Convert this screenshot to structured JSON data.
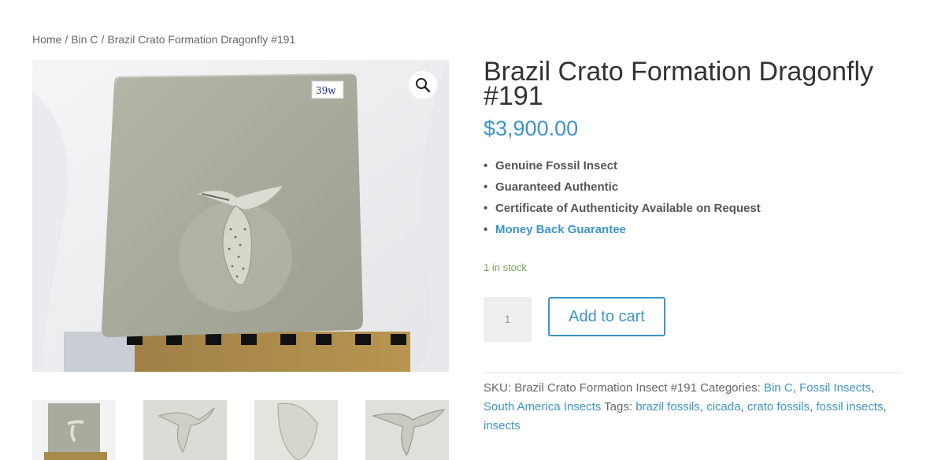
{
  "breadcrumb": {
    "items": [
      "Home",
      "Bin C"
    ],
    "separator": "/",
    "current": "Brazil Crato Formation Dragonfly #191"
  },
  "product": {
    "title": "Brazil Crato Formation Dragonfly #191",
    "price": "$3,900.00",
    "features": [
      "Genuine Fossil Insect",
      "Guaranteed Authentic",
      "Certificate of Authenticity Available on Request",
      "Money Back Guarantee"
    ],
    "stock": "1 in stock",
    "quantity": "1",
    "add_to_cart": "Add to cart",
    "image_label": "39w",
    "sku_label": "SKU:",
    "sku": "Brazil Crato Formation Insect #191",
    "categories_label": "Categories:",
    "categories": [
      "Bin C",
      "Fossil Insects",
      "South America Insects"
    ],
    "tags_label": "Tags:",
    "tags": [
      "brazil fossils",
      "cicada",
      "crato fossils",
      "fossil insects",
      "insects"
    ]
  },
  "colors": {
    "link": "#3d94c9",
    "stock": "#77a464",
    "text": "#333333"
  },
  "icons": {
    "zoom": "magnifier-icon"
  }
}
